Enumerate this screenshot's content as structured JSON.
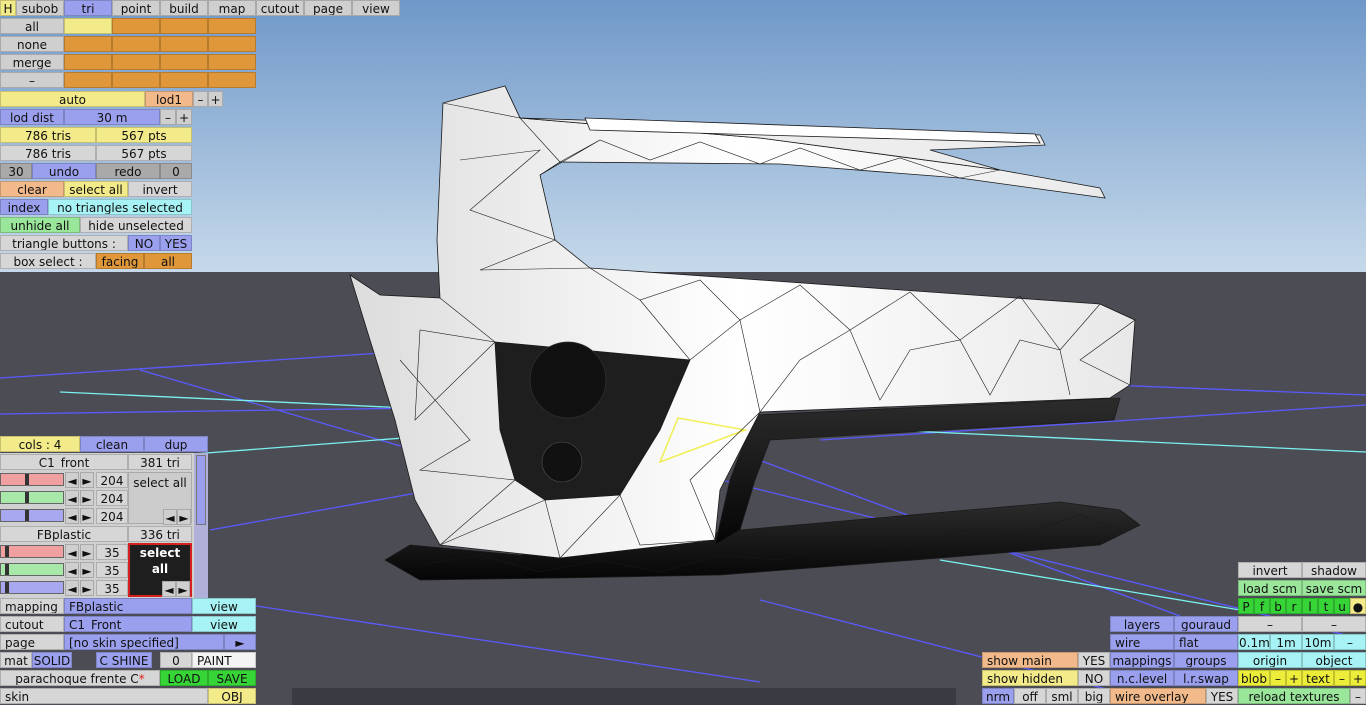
{
  "topbar": {
    "h": "H",
    "subob": "subob",
    "tri": "tri",
    "point": "point",
    "build": "build",
    "map": "map",
    "cutout": "cutout",
    "page": "page",
    "view": "view"
  },
  "sel": {
    "all": "all",
    "none": "none",
    "merge": "merge",
    "dash": "–"
  },
  "lod": {
    "auto": "auto",
    "level": "lod1",
    "minus": "–",
    "plus": "+",
    "dist_label": "lod dist",
    "dist_value": "30 m"
  },
  "counts": {
    "tris1": "786 tris",
    "pts1": "567 pts",
    "tris2": "786 tris",
    "pts2": "567 pts"
  },
  "undo_row": {
    "num": "30",
    "undo": "undo",
    "redo": "redo",
    "zero": "0"
  },
  "edit": {
    "clear": "clear",
    "select_all": "select all",
    "invert": "invert"
  },
  "index": {
    "label": "index",
    "status": "no triangles selected"
  },
  "hide": {
    "unhide_all": "unhide all",
    "hide_unselected": "hide unselected"
  },
  "tri_buttons": {
    "label": "triangle buttons :",
    "no": "NO",
    "yes": "YES"
  },
  "box_select": {
    "label": "box select :",
    "facing": "facing",
    "all": "all"
  },
  "cols": {
    "label": "cols : 4",
    "clean": "clean",
    "dup": "dup"
  },
  "materials": [
    {
      "name": "C1_front",
      "tris": "381 tri",
      "r": "204",
      "g": "204",
      "b": "204",
      "select": "select all",
      "bars": [
        0.42,
        0.42,
        0.42
      ]
    },
    {
      "name": "FBplastic",
      "tris": "336 tri",
      "r": "35",
      "g": "35",
      "b": "35",
      "select": "select all",
      "bars": [
        0.07,
        0.07,
        0.07
      ]
    }
  ],
  "arrows": {
    "left": "◄",
    "right": "►"
  },
  "mapping": {
    "label": "mapping",
    "value": "FBplastic",
    "view": "view"
  },
  "cutout": {
    "label": "cutout",
    "value": "C1_Front",
    "view": "view"
  },
  "page": {
    "label": "page",
    "value": "[no skin specified]",
    "arrow": "►"
  },
  "mat": {
    "label": "mat",
    "solid": "SOLID",
    "cshine": "C SHINE",
    "zero": "0",
    "paint": "PAINT"
  },
  "file": {
    "name": "parachoque frente C",
    "star": "*",
    "load": "LOAD",
    "save": "SAVE"
  },
  "skin": {
    "label": "skin",
    "obj": "OBJ"
  },
  "right": {
    "invert": "invert",
    "shadow": "shadow",
    "load_scm": "load scm",
    "save_scm": "save scm",
    "flags": [
      "P",
      "f",
      "b",
      "r",
      "l",
      "t",
      "u"
    ],
    "dot": "●",
    "dash": "–",
    "layers": "layers",
    "gouraud": "gouraud",
    "wire": "wire",
    "flat": "flat",
    "s01": "0.1m",
    "s1": "1m",
    "s10": "10m",
    "mappings": "mappings",
    "groups": "groups",
    "origin": "origin",
    "object": "object",
    "nclevel": "n.c.level",
    "lrswap": "l.r.swap",
    "blob": "blob",
    "text": "text",
    "minus": "–",
    "plus": "+",
    "wire_overlay": "wire overlay",
    "yes": "YES",
    "reload": "reload textures"
  },
  "show": {
    "main": "show main",
    "main_val": "YES",
    "hidden": "show hidden",
    "hidden_val": "NO"
  },
  "size": {
    "nrm": "nrm",
    "off": "off",
    "sml": "sml",
    "big": "big"
  },
  "colors": {
    "sky_top": "#6f98c9",
    "sky_bottom": "#c6d9ea",
    "ground": "#4c4c55",
    "grid_blue": "#5a5aff",
    "grid_cyan": "#7af0f0",
    "selected": "#f2ee5a"
  }
}
